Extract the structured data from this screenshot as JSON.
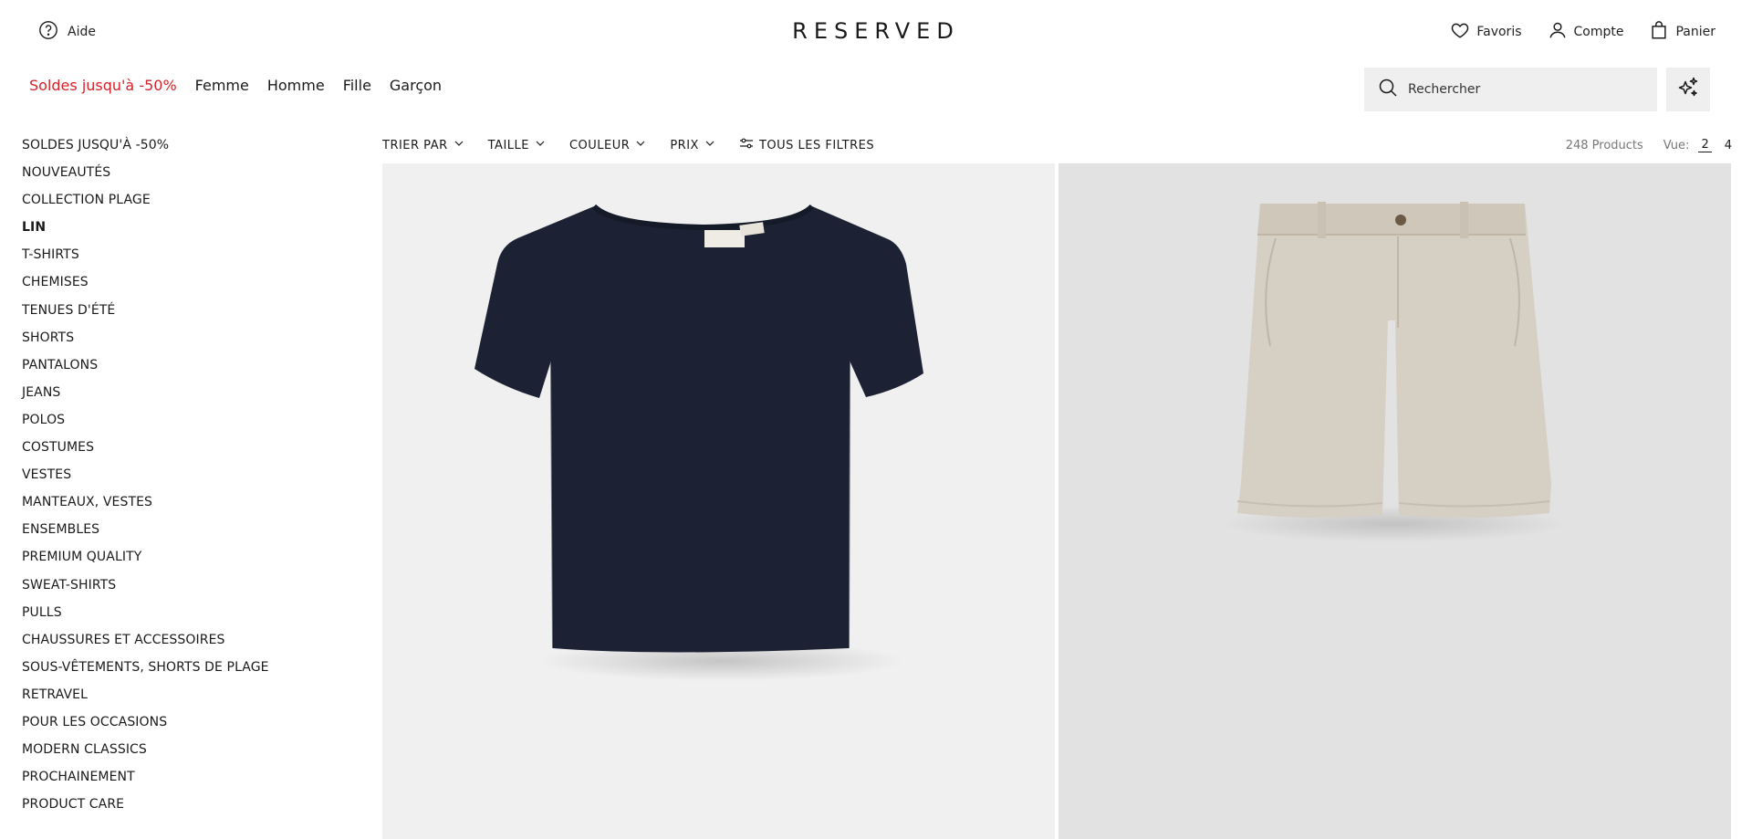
{
  "header": {
    "help_label": "Aide",
    "logo": "RESERVED",
    "favorites_label": "Favoris",
    "account_label": "Compte",
    "cart_label": "Panier"
  },
  "nav": {
    "items": [
      {
        "label": "Soldes jusqu'à -50%",
        "color": "#d62128"
      },
      {
        "label": "Femme"
      },
      {
        "label": "Homme"
      },
      {
        "label": "Fille"
      },
      {
        "label": "Garçon"
      }
    ]
  },
  "search": {
    "placeholder": "Rechercher"
  },
  "sidebar": {
    "active": "LIN",
    "items": [
      "SOLDES JUSQU'À -50%",
      "NOUVEAUTÉS",
      "COLLECTION PLAGE",
      "LIN",
      "T-SHIRTS",
      "CHEMISES",
      "TENUES D'ÉTÉ",
      "SHORTS",
      "PANTALONS",
      "JEANS",
      "POLOS",
      "COSTUMES",
      "VESTES",
      "MANTEAUX, VESTES",
      "ENSEMBLES",
      "PREMIUM QUALITY",
      "SWEAT-SHIRTS",
      "PULLS",
      "CHAUSSURES ET ACCESSOIRES",
      "SOUS-VÊTEMENTS, SHORTS DE PLAGE",
      "RETRAVEL",
      "POUR LES OCCASIONS",
      "MODERN CLASSICS",
      "PROCHAINEMENT",
      "PRODUCT CARE"
    ]
  },
  "filters": {
    "sort": "TRIER PAR",
    "size": "TAILLE",
    "color": "COULEUR",
    "price": "PRIX",
    "all": "TOUS LES FILTRES"
  },
  "listing": {
    "count": "248 Products",
    "view_label": "Vue:",
    "view_options": [
      "2",
      "4"
    ],
    "view_selected": "2"
  },
  "products": [
    {
      "image": "navy-tshirt",
      "color": "#1c2233"
    },
    {
      "image": "beige-linen-shorts",
      "color": "#d6cfc3"
    }
  ]
}
